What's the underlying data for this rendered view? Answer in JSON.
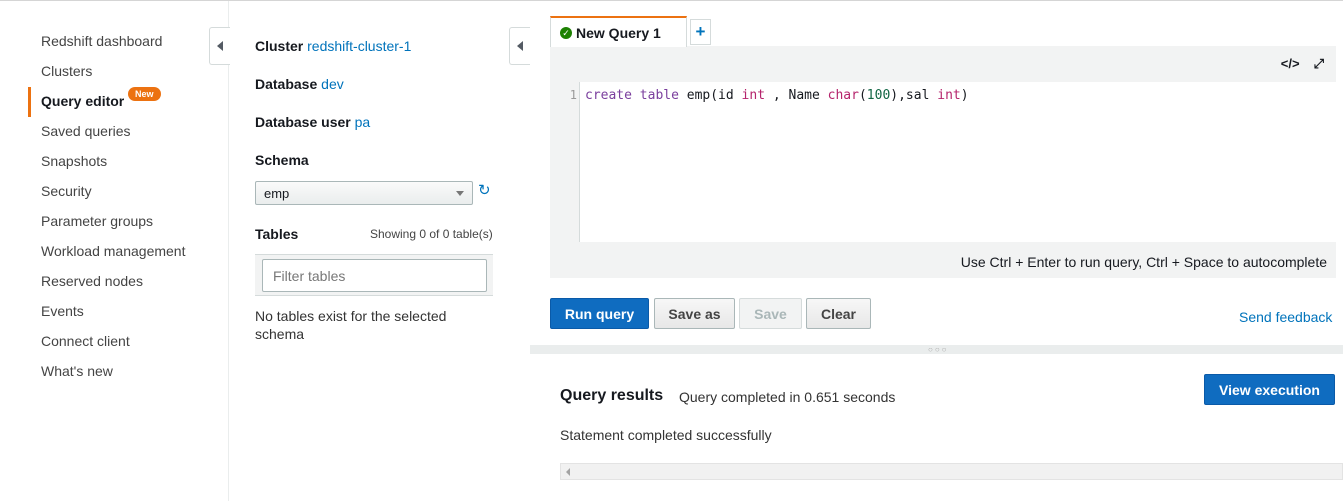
{
  "nav": {
    "items": [
      {
        "label": "Redshift dashboard"
      },
      {
        "label": "Clusters"
      },
      {
        "label": "Query editor",
        "active": true,
        "badge": "New"
      },
      {
        "label": "Saved queries"
      },
      {
        "label": "Snapshots"
      },
      {
        "label": "Security"
      },
      {
        "label": "Parameter groups"
      },
      {
        "label": "Workload management"
      },
      {
        "label": "Reserved nodes"
      },
      {
        "label": "Events"
      },
      {
        "label": "Connect client"
      },
      {
        "label": "What's new"
      }
    ]
  },
  "connection": {
    "cluster_label": "Cluster",
    "cluster_value": "redshift-cluster-1",
    "database_label": "Database",
    "database_value": "dev",
    "user_label": "Database user",
    "user_value": "pa"
  },
  "schema": {
    "title": "Schema",
    "selected": "emp"
  },
  "tables": {
    "title": "Tables",
    "count_text": "Showing 0 of 0 table(s)",
    "filter_placeholder": "Filter tables",
    "empty_message": "No tables exist for the selected schema"
  },
  "editor": {
    "tab_label": "New Query 1",
    "add_tab": "+",
    "line_number": "1",
    "code_tokens": {
      "t1": "create table",
      "t2": " emp(id ",
      "t3": "int",
      "t4": " , Name ",
      "t5": "char",
      "t6": "(",
      "t7": "100",
      "t8": "),sal ",
      "t9": "int",
      "t10": ")"
    },
    "code_tool": "</>",
    "expand_tool": "⤢",
    "hint": "Use Ctrl + Enter to run query, Ctrl + Space to autocomplete"
  },
  "actions": {
    "run": "Run query",
    "save_as": "Save as",
    "save": "Save",
    "clear": "Clear",
    "feedback": "Send feedback"
  },
  "results": {
    "title": "Query results",
    "time": "Query completed in 0.651 seconds",
    "view_execution": "View execution",
    "statement": "Statement completed successfully"
  },
  "icons": {
    "refresh": "refresh-icon",
    "check": "check-circle-icon",
    "collapse": "caret-left-icon"
  },
  "colors": {
    "accent": "#ec7211",
    "primary": "#0f6cc0",
    "link": "#0073bb",
    "success": "#1d8102"
  }
}
